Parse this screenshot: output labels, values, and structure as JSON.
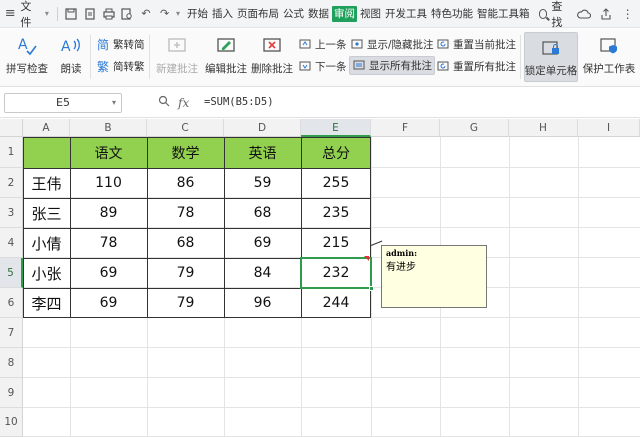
{
  "menu": {
    "file_label": "文件",
    "tabs": [
      "开始",
      "插入",
      "页面布局",
      "公式",
      "数据",
      "审阅",
      "视图",
      "开发工具",
      "特色功能",
      "智能工具箱"
    ],
    "active_tab": "审阅",
    "search_label": "查找"
  },
  "ribbon": {
    "spellcheck": "拼写检查",
    "read_aloud": "朗读",
    "trad_to_simp": "繁转简",
    "simp_to_trad": "简转繁",
    "new_comment": "新建批注",
    "edit_comment": "编辑批注",
    "delete_comment": "删除批注",
    "prev": "上一条",
    "next": "下一条",
    "show_hide_comment": "显示/隐藏批注",
    "show_all_comments": "显示所有批注",
    "reset_current_comment": "重置当前批注",
    "reset_all_comments": "重置所有批注",
    "lock_cell": "锁定单元格",
    "protect_sheet": "保护工作表"
  },
  "formula_bar": {
    "name_box": "E5",
    "fx_label": "fx",
    "formula": "=SUM(B5:D5)"
  },
  "sheet": {
    "columns": [
      "A",
      "B",
      "C",
      "D",
      "E",
      "F",
      "G",
      "H",
      "I"
    ],
    "rows": [
      "1",
      "2",
      "3",
      "4",
      "5",
      "6",
      "7",
      "8",
      "9",
      "10"
    ],
    "header": [
      "",
      "语文",
      "数学",
      "英语",
      "总分"
    ],
    "data": [
      [
        "王伟",
        "110",
        "86",
        "59",
        "255"
      ],
      [
        "张三",
        "89",
        "78",
        "68",
        "235"
      ],
      [
        "小倩",
        "78",
        "68",
        "69",
        "215"
      ],
      [
        "小张",
        "69",
        "79",
        "84",
        "232"
      ],
      [
        "李四",
        "69",
        "79",
        "96",
        "244"
      ]
    ],
    "selected_cell": "E5",
    "header_fill": "#92d050",
    "selection_color": "#2f9c4d"
  },
  "comment": {
    "author": "admin:",
    "text": "有进步"
  }
}
